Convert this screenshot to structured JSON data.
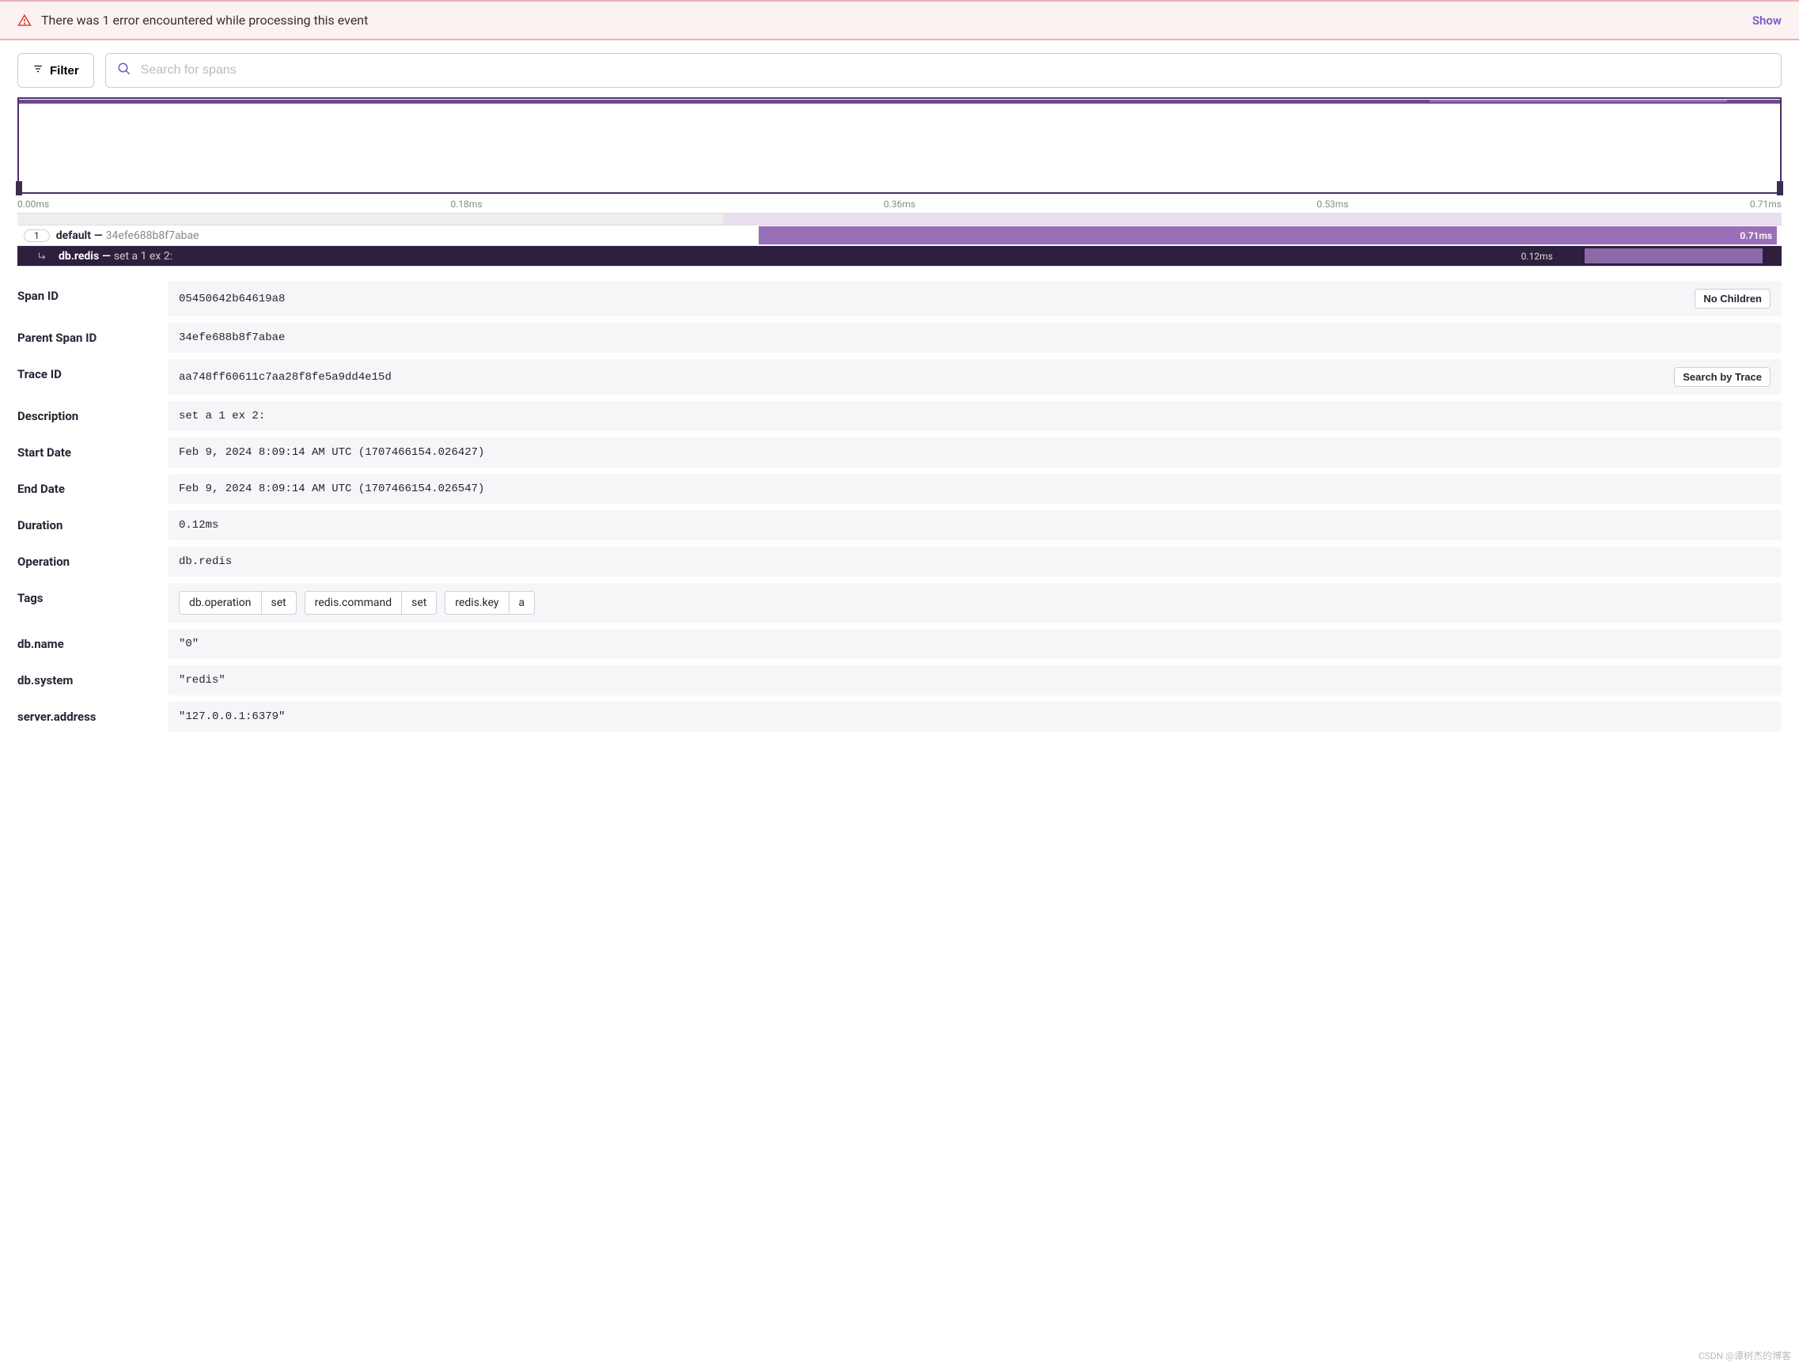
{
  "errorBanner": {
    "message": "There was 1 error encountered while processing this event",
    "action": "Show"
  },
  "filter": {
    "label": "Filter"
  },
  "search": {
    "placeholder": "Search for spans"
  },
  "timeline": {
    "ticks": [
      "0.00ms",
      "0.18ms",
      "0.36ms",
      "0.53ms",
      "0.71ms"
    ]
  },
  "spans": {
    "parent": {
      "count": "1",
      "name": "default",
      "id": "34efe688b8f7abae",
      "duration": "0.71ms"
    },
    "child": {
      "operation": "db.redis",
      "description": "set a 1 ex 2:",
      "duration": "0.12ms"
    }
  },
  "details": {
    "spanId": {
      "label": "Span ID",
      "value": "05450642b64619a8",
      "noChildren": "No Children"
    },
    "parentSpanId": {
      "label": "Parent Span ID",
      "value": "34efe688b8f7abae"
    },
    "traceId": {
      "label": "Trace ID",
      "value": "aa748ff60611c7aa28f8fe5a9dd4e15d",
      "searchBtn": "Search by Trace"
    },
    "description": {
      "label": "Description",
      "value": "set a 1 ex 2:"
    },
    "startDate": {
      "label": "Start Date",
      "value": "Feb 9, 2024 8:09:14 AM UTC (1707466154.026427)"
    },
    "endDate": {
      "label": "End Date",
      "value": "Feb 9, 2024 8:09:14 AM UTC (1707466154.026547)"
    },
    "duration": {
      "label": "Duration",
      "value": "0.12ms"
    },
    "operation": {
      "label": "Operation",
      "value": "db.redis"
    },
    "tags": {
      "label": "Tags",
      "items": [
        {
          "key": "db.operation",
          "value": "set"
        },
        {
          "key": "redis.command",
          "value": "set"
        },
        {
          "key": "redis.key",
          "value": "a"
        }
      ]
    },
    "dbName": {
      "label": "db.name",
      "value": "\"0\""
    },
    "dbSystem": {
      "label": "db.system",
      "value": "\"redis\""
    },
    "serverAddress": {
      "label": "server.address",
      "value": "\"127.0.0.1:6379\""
    }
  },
  "watermark": "CSDN @谭树杰的博客"
}
